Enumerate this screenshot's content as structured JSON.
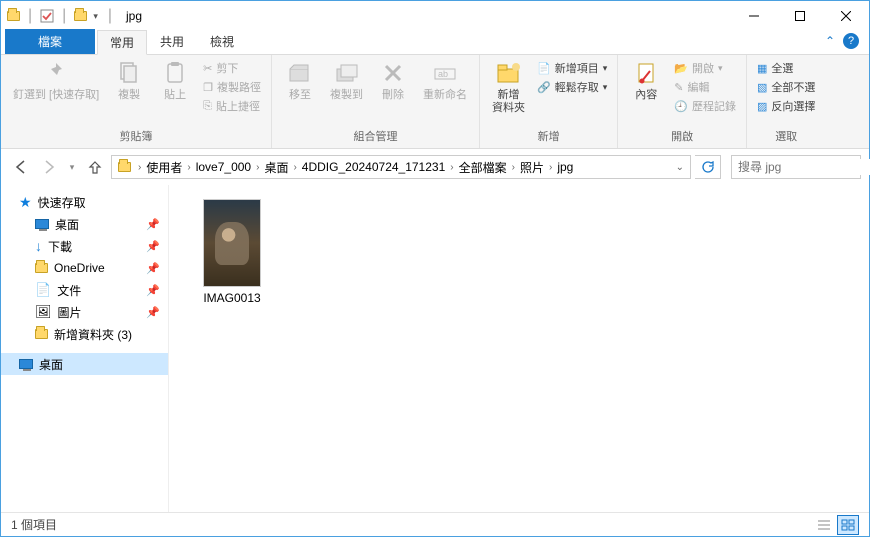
{
  "title": "jpg",
  "tabs": {
    "file": "檔案",
    "home": "常用",
    "share": "共用",
    "view": "檢視"
  },
  "ribbon": {
    "clipboard": {
      "pin": "釘選到 [快速存取]",
      "copy": "複製",
      "paste": "貼上",
      "cut": "剪下",
      "copypath": "複製路徑",
      "pasteshortcut": "貼上捷徑",
      "label": "剪貼簿"
    },
    "organize": {
      "moveto": "移至",
      "copyto": "複製到",
      "delete": "刪除",
      "rename": "重新命名",
      "label": "組合管理"
    },
    "new": {
      "newfolder": "新增\n資料夾",
      "newitem": "新增項目",
      "easyaccess": "輕鬆存取",
      "label": "新增"
    },
    "open": {
      "properties": "內容",
      "open": "開啟",
      "edit": "編輯",
      "history": "歷程記錄",
      "label": "開啟"
    },
    "select": {
      "all": "全選",
      "none": "全部不選",
      "invert": "反向選擇",
      "label": "選取"
    }
  },
  "breadcrumb": [
    "使用者",
    "love7_000",
    "桌面",
    "4DDIG_20240724_171231",
    "全部檔案",
    "照片",
    "jpg"
  ],
  "search_placeholder": "搜尋 jpg",
  "nav": {
    "quick": "快速存取",
    "desktop": "桌面",
    "downloads": "下載",
    "onedrive": "OneDrive",
    "documents": "文件",
    "pictures": "圖片",
    "newfolder3": "新增資料夾 (3)",
    "desktop2": "桌面"
  },
  "files": [
    {
      "name": "IMAG0013"
    }
  ],
  "status": "1 個項目"
}
